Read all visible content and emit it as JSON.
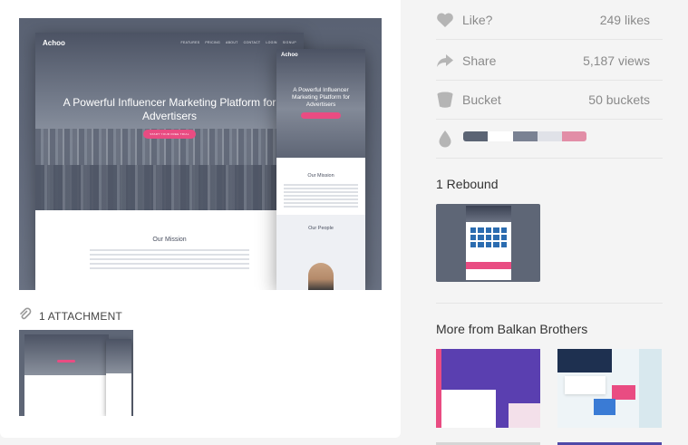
{
  "shot": {
    "desktop": {
      "logo": "Achoo",
      "nav": [
        "FEATURES",
        "PRICING",
        "ABOUT",
        "CONTACT",
        "LOGIN",
        "SIGNUP"
      ],
      "hero_title": "A Powerful Influencer Marketing Platform for Advertisers",
      "cta": "START YOUR FREE TRIAL",
      "mission_title": "Our Mission"
    },
    "mobile": {
      "logo": "Achoo",
      "hero_title": "A Powerful Influencer Marketing Platform for Advertisers",
      "mission_title": "Our Mission",
      "people_title": "Our People"
    }
  },
  "attachments": {
    "label": "1 ATTACHMENT"
  },
  "stats": {
    "like": {
      "label": "Like?",
      "value": "249 likes"
    },
    "share": {
      "label": "Share",
      "value": "5,187 views"
    },
    "bucket": {
      "label": "Bucket",
      "value": "50 buckets"
    }
  },
  "palette": [
    "#5b6474",
    "#ffffff",
    "#7a8293",
    "#e0e2e8",
    "#e28ea7"
  ],
  "rebounds": {
    "title": "1 Rebound"
  },
  "more": {
    "title": "More from Balkan Brothers"
  },
  "icons": {
    "like": "heart-icon",
    "share": "share-arrow-icon",
    "bucket": "bucket-icon",
    "colors": "drop-icon",
    "attachment": "paperclip-icon"
  },
  "colors": {
    "accent_pink": "#e94c82",
    "icon_gray": "#b5b5b5",
    "text_gray": "#8a8a8a"
  }
}
